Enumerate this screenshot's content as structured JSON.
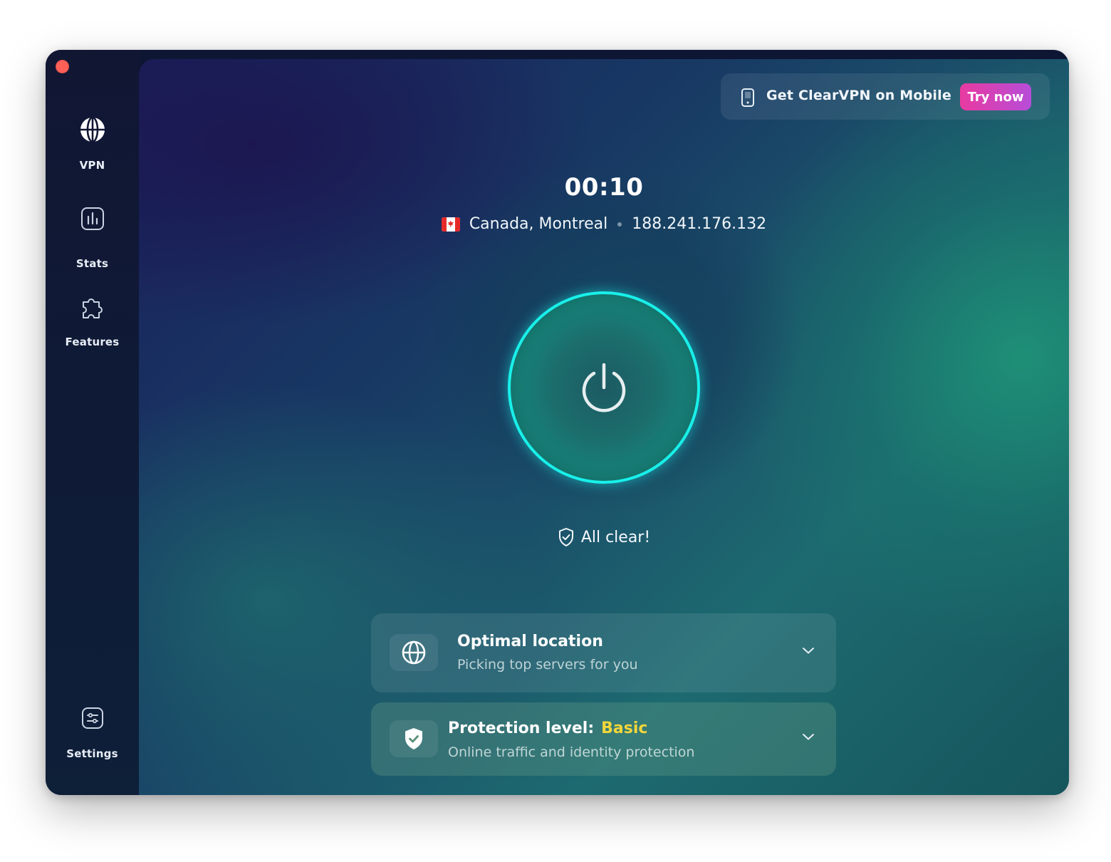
{
  "sidebar": {
    "items": [
      {
        "label": "VPN",
        "icon": "globe-icon"
      },
      {
        "label": "Stats",
        "icon": "chart-icon"
      },
      {
        "label": "Features",
        "icon": "puzzle-icon"
      }
    ],
    "settings": {
      "label": "Settings",
      "icon": "sliders-icon"
    }
  },
  "promo": {
    "text": "Get ClearVPN on Mobile",
    "button": "Try now",
    "icon": "phone-icon"
  },
  "connection": {
    "timer": "00:10",
    "country": "Canada, Montreal",
    "ip": "188.241.176.132",
    "flag": "canada-flag",
    "status": "All clear!"
  },
  "cards": {
    "location": {
      "title": "Optimal location",
      "subtitle": "Picking top servers for you"
    },
    "protection": {
      "title": "Protection level:",
      "level": "Basic",
      "subtitle": "Online traffic and identity protection"
    }
  },
  "colors": {
    "accent_ring": "#19f0ea",
    "try_now_start": "#e83aa0",
    "try_now_end": "#b74dd8",
    "level_basic": "#f2d63a",
    "close_button": "#fe5f57"
  }
}
